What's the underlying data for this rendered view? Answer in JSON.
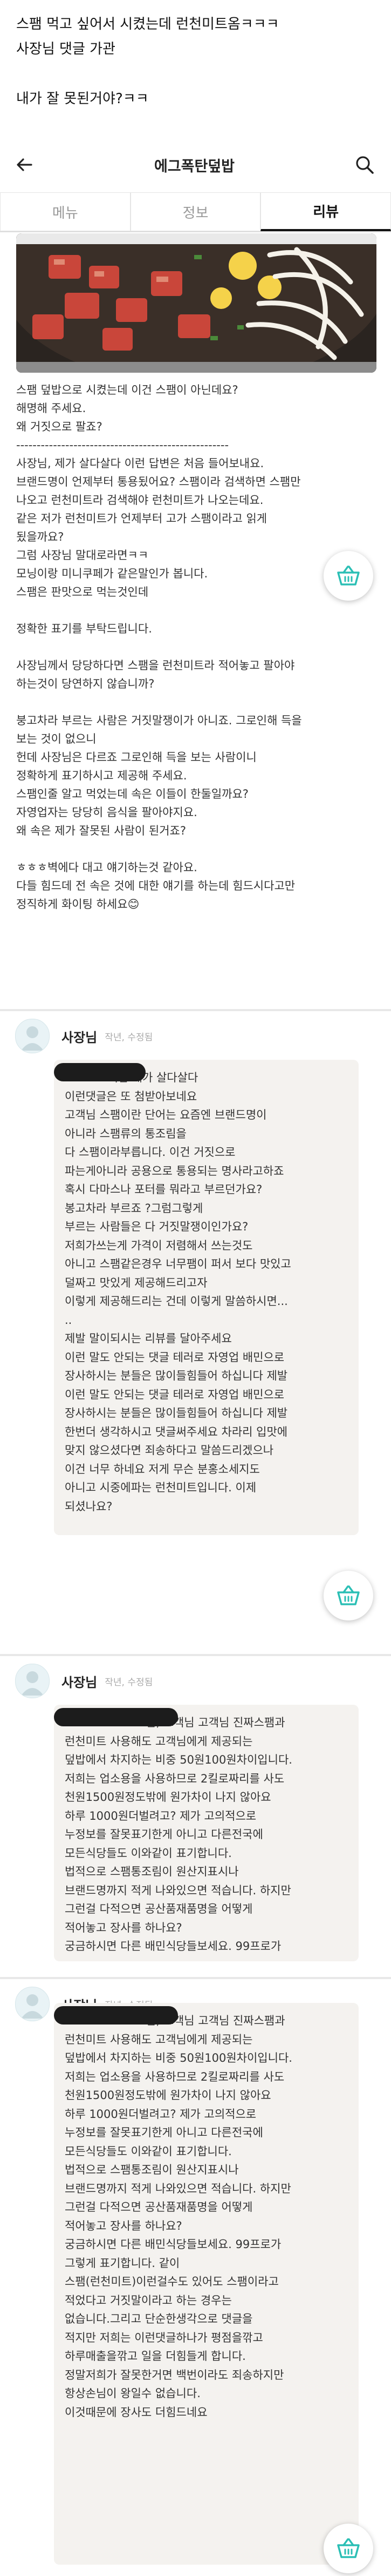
{
  "caption": {
    "lines": [
      "스팸 먹고 싶어서 시켰는데 런천미트옴ㅋㅋㅋ",
      "사장님 댓글 가관",
      "",
      "내가 잘 못된거야?ㅋㅋ"
    ]
  },
  "header": {
    "title": "에그폭탄덮밥",
    "back_icon": "arrow-left-icon",
    "search_icon": "search-icon"
  },
  "tabs": [
    {
      "label": "메뉴"
    },
    {
      "label": "정보"
    },
    {
      "label": "리뷰"
    }
  ],
  "review": {
    "lines": [
      "스팸 덮밥으로 시켰는데 이건 스팸이 아닌데요?",
      "해명해 주세요.",
      "왜 거짓으로 팔죠?",
      "----------------------------------------------------",
      "사장님, 제가 살다살다 이런 답변은 처음 들어보내요.",
      "브랜드명이 언제부터 통용됬어요? 스팸이라 검색하면 스팸만",
      "나오고 런천미트라 검색해야 런천미트가 나오는데요.",
      "같은 저가 런천미트가 언제부터 고가 스팸이라고 읽게",
      "됬을까요?",
      "그럼 사장님 말대로라면ㅋㅋ",
      "모닝이랑 미니쿠페가 같은말인가 봅니다.",
      "스팸은 판맛으로 먹는것인데",
      "",
      "정확한 표기를 부탁드립니다.",
      "",
      "사장님께서 당당하다면 스팸을 런천미트라 적어놓고 팔아야",
      "하는것이 당연하지 않습니까?",
      "",
      "붕고차라 부르는 사람은 거짓말쟁이가 아니죠. 그로인해 득을",
      "보는 것이 없으니",
      "헌데 사장님은 다르죠 그로인해 득을 보는 사람이니",
      "정확하게 표기하시고 제공해 주세요.",
      "스팸인줄 알고 먹었는데 속은 이들이 한둘일까요?",
      "자영업자는 당당히 음식을 팔아야지요.",
      "왜 속은 제가 잘못된 사람이 된거죠?",
      "",
      "ㅎㅎㅎ벽에다 대고 얘기하는것 같아요.",
      "다들 힘드데 전 속은 것에 대한 얘기를 하는데 힘드시다고만",
      "정직하게 화이팅 하세요😊"
    ]
  },
  "owner_replies": [
    {
      "name": "사장님",
      "meta": "작년, 수정됨",
      "lines": [
        "고객님 제가 살다살다",
        "이런댓글은 또 첨받아보네요",
        "고객님 스팸이란 단어는 요즘엔 브랜드명이",
        "아니라 스팸류의 통조림을",
        "다 스팸이라부릅니다. 이건 거짓으로",
        "파는게아니라 공용으로 통용되는 명사라고하죠",
        "혹시 다마스나 포터를 뭐라고 부르던가요?",
        "봉고차라 부르죠 ?그럼그렇게",
        "부르는 사람들은 다 거짓말쟁이인가요?",
        "저희가쓰는게 가격이 저렴해서 쓰는것도",
        "아니고 스팸같은경우 너무팸이 퍼서 보다 맛있고",
        "덜짜고 맛있게 제공해드리고자",
        "이렇게 제공해드리는 건데 이렇게 말씀하시면...",
        "..",
        "제발 말이되시는 리뷰를 달아주세요",
        "이런 말도 안되는 댓글 테러로 자영업 배민으로",
        "장사하시는 분들은 많이들힘들어 하십니다 제발",
        "이런 말도 안되는 댓글 테러로 자영업 배민으로",
        "장사하시는 분들은 많이들힘들어 하십니다 제발",
        "한번더 생각하시고 댓글써주세요 차라리 입맛에",
        "맞지 않으셨다면 죄송하다고 말씀드리겠으나",
        "이건 너무 하네요 저게 무슨 분홍소세지도",
        "아니고 시중에파는 런천미트입니다. 이제",
        "되셨나요?"
      ]
    },
    {
      "name": "사장님",
      "meta": "작년, 수정됨",
      "lines": [
        "님, 고객님 고객님 진짜스팸과",
        "런천미트 사용해도 고객님에게 제공되는",
        "덮밥에서 차지하는 비중 50원100원차이입니다.",
        "저희는 업소용을 사용하므로 2킬로짜리를 사도",
        "천원1500원정도밖에 원가차이 나지 않아요",
        "하루 1000원더벌려고? 제가 고의적으로",
        "누정보를 잘못표기한게 아니고 다른전국에",
        "모든식당들도 이와같이 표기합니다.",
        "법적으로 스팸통조림이 원산지표시나",
        "브랜드명까지 적게 나와있으면 적습니다. 하지만",
        "그런걸 다적으면 공산품재품명을 어떻게",
        "적어놓고 장사를 하나요?",
        "궁금하시면 다른 배민식당들보세요. 99프로가"
      ]
    },
    {
      "name": "사장님",
      "meta": "작년, 수정됨",
      "lines": [
        "님, 고객님 고객님 진짜스팸과",
        "런천미트 사용해도 고객님에게 제공되는",
        "덮밥에서 차지하는 비중 50원100원차이입니다.",
        "저희는 업소용을 사용하므로 2킬로짜리를 사도",
        "천원1500원정도밖에 원가차이 나지 않아요",
        "하루 1000원더벌려고? 제가 고의적으로",
        "누정보를 잘못표기한게 아니고 다른전국에",
        "모든식당들도 이와같이 표기합니다.",
        "법적으로 스팸통조림이 원산지표시나",
        "브랜드명까지 적게 나와있으면 적습니다. 하지만",
        "그런걸 다적으면 공산품재품명을 어떻게",
        "적어놓고 장사를 하나요?",
        "궁금하시면 다른 배민식당들보세요. 99프로가",
        "그렇게 표기합니다. 같이",
        "스팸(런천미트)이런걸수도 있어도 스팸이라고",
        "적었다고 거짓말이라고 하는 경우는",
        "없습니다.그리고 단순한생각으로 댓글을",
        "적지만 저희는 이런댓글하나가 평점을깎고",
        "하루매출을깎고 일을 더힘들게 합니다.",
        "정말저희가 잘못한거면 백번이라도 죄송하지만",
        "항상손님이 왕일수 없습니다.",
        "이것때문에 장사도 더힘드네요"
      ]
    }
  ]
}
